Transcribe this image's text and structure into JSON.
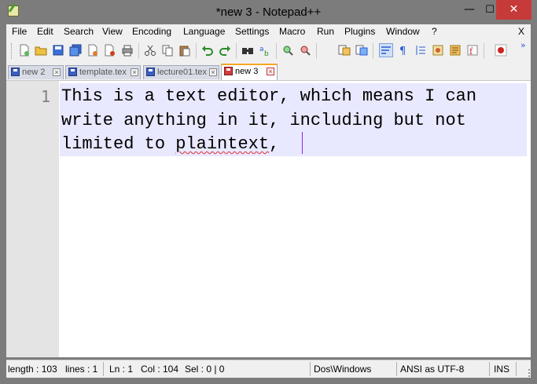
{
  "window": {
    "title": "*new  3 - Notepad++",
    "controls": {
      "minimize": "—",
      "maximize": "☐",
      "close": "✕"
    }
  },
  "menu": {
    "items": [
      "File",
      "Edit",
      "Search",
      "View",
      "Encoding",
      "Language",
      "Settings",
      "Macro",
      "Run",
      "Plugins",
      "Window",
      "?"
    ],
    "close_doc": "X"
  },
  "toolbar": {
    "buttons": [
      "new-file-icon",
      "open-file-icon",
      "save-icon",
      "save-all-icon",
      "close-icon",
      "close-all-icon",
      "print-icon",
      "cut-icon",
      "copy-icon",
      "paste-icon",
      "undo-icon",
      "redo-icon",
      "find-icon",
      "replace-icon",
      "zoom-in-icon",
      "zoom-out-icon",
      "sync-vertical-icon",
      "sync-horizontal-icon",
      "word-wrap-icon",
      "show-all-chars-icon",
      "indent-guide-icon",
      "user-lang-icon",
      "doc-map-icon",
      "function-list-icon",
      "record-macro-icon"
    ],
    "overflow": "»"
  },
  "tabs": [
    {
      "label": "new  2",
      "active": false
    },
    {
      "label": "template.tex",
      "active": false
    },
    {
      "label": "lecture01.tex",
      "active": false
    },
    {
      "label": "new  3",
      "active": true
    }
  ],
  "editor": {
    "line_number": "1",
    "lines": [
      "This is a text editor, which means I can",
      "write anything in it, including but not",
      "limited to "
    ],
    "misspelled_word": "plaintext",
    "after_word": ", "
  },
  "status": {
    "length": "length : 103",
    "lines": "lines : 1",
    "ln": "Ln : 1",
    "col": "Col : 104",
    "sel": "Sel : 0 | 0",
    "eol": "Dos\\Windows",
    "encoding": "ANSI as UTF-8",
    "mode": "INS"
  },
  "colors": {
    "accent_tab": "#f5a623",
    "current_line": "#e8e8ff",
    "caret": "#8a2be2",
    "close_button": "#c73a3a"
  }
}
